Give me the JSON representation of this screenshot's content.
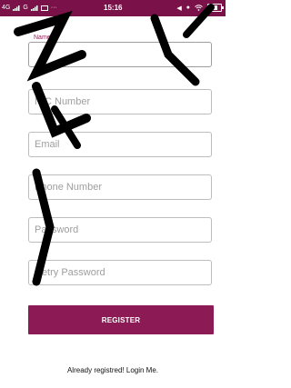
{
  "status_bar": {
    "network_left": "4G",
    "signal_text": "G",
    "clock": "15:16",
    "extra": "···"
  },
  "form": {
    "name_label": "Name",
    "nic_placeholder": "NIC Number",
    "email_placeholder": "Email",
    "phone_placeholder": "Phone Number",
    "password_placeholder": "Password",
    "retry_password_placeholder": "Retry Password",
    "register_label": "REGISTER"
  },
  "footer": {
    "login_text": "Already registred! Login Me."
  },
  "colors": {
    "primary": "#8b1a55",
    "status_bar": "#7a1149"
  }
}
